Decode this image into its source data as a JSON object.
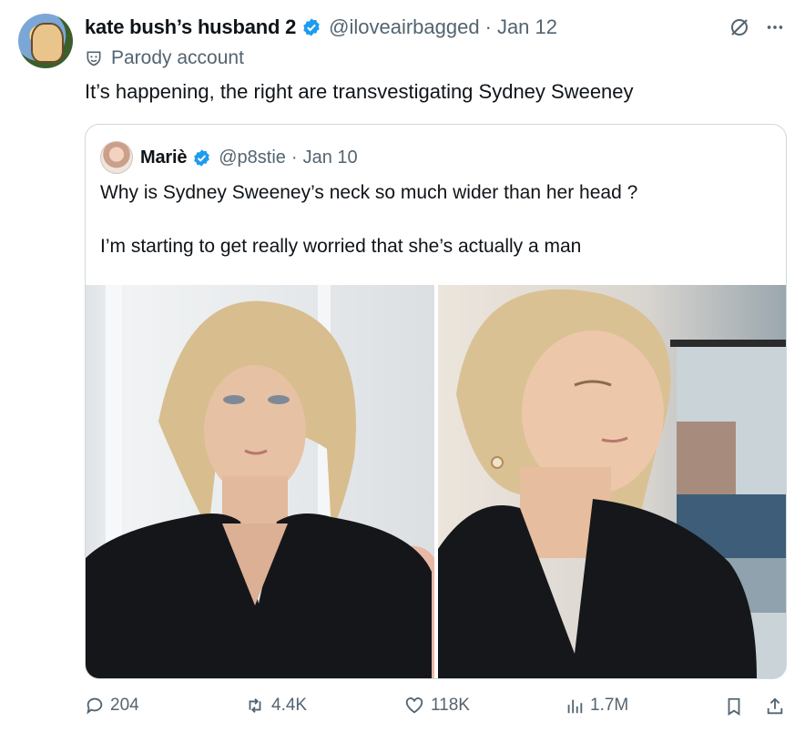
{
  "tweet": {
    "author_name": "kate bush’s husband 2",
    "handle": "@iloveairbagged",
    "separator": "·",
    "date": "Jan 12",
    "label": "Parody account",
    "text": "It’s happening, the right are transvestigating Sydney Sweeney"
  },
  "quoted": {
    "author_name": "Mariè",
    "handle": "@p8stie",
    "separator": "·",
    "date": "Jan 10",
    "line1": "Why is Sydney Sweeney’s neck so much wider than her head ?",
    "line2": "I’m starting to get really worried that she’s actually a man"
  },
  "stats": {
    "replies": "204",
    "reposts": "4.4K",
    "likes": "118K",
    "views": "1.7M"
  },
  "colors": {
    "verified": "#1d9bf0",
    "secondary_text": "#536471",
    "border": "#cfd9de"
  },
  "icons": [
    "grok-icon",
    "more-icon",
    "parody-icon",
    "verified-badge-icon",
    "reply-icon",
    "repost-icon",
    "like-icon",
    "views-icon",
    "bookmark-icon",
    "share-icon"
  ]
}
